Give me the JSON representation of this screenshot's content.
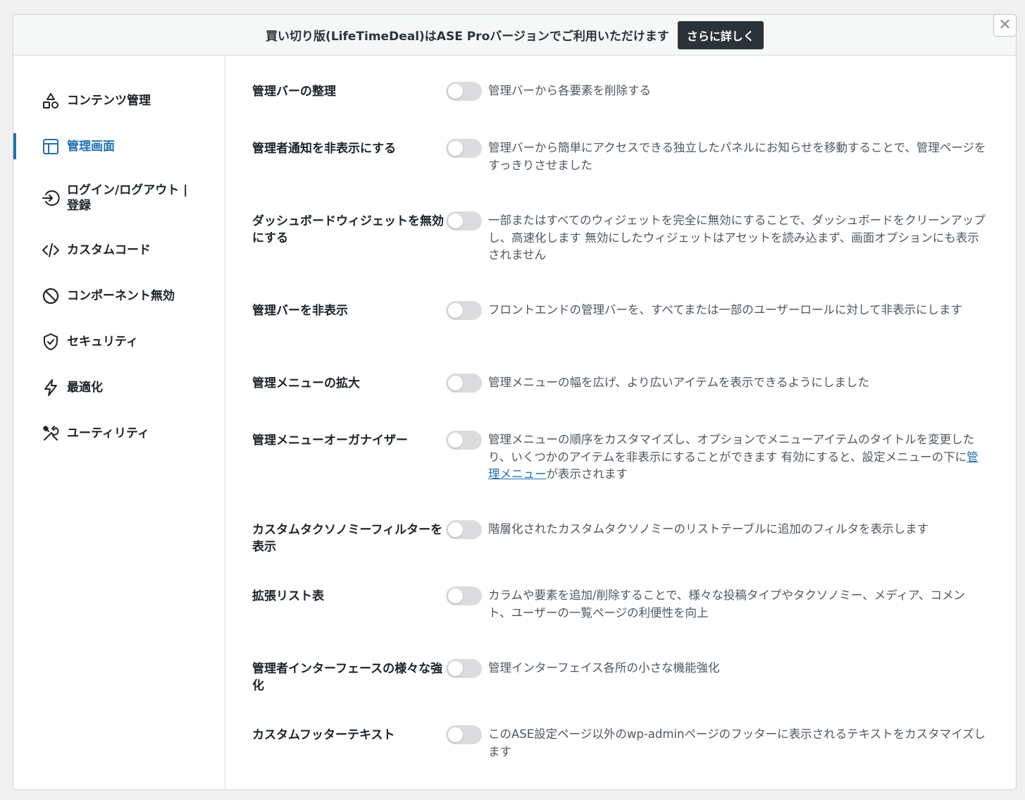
{
  "banner": {
    "text": "買い切り版(LifeTimeDeal)はASE Proバージョンでご利用いただけます",
    "button_label": "さらに詳しく"
  },
  "close_label": "✕",
  "sidebar": {
    "items": [
      {
        "label": "コンテンツ管理",
        "icon": "shapes-icon"
      },
      {
        "label": "管理画面",
        "icon": "layout-icon",
        "active": true
      },
      {
        "label": "ログイン/ログアウト | 登録",
        "icon": "login-icon"
      },
      {
        "label": "カスタムコード",
        "icon": "code-icon"
      },
      {
        "label": "コンポーネント無効",
        "icon": "ban-icon"
      },
      {
        "label": "セキュリティ",
        "icon": "shield-check-icon"
      },
      {
        "label": "最適化",
        "icon": "lightning-icon"
      },
      {
        "label": "ユーティリティ",
        "icon": "tools-icon"
      }
    ]
  },
  "settings": [
    {
      "title": "管理バーの整理",
      "desc": "管理バーから各要素を削除する",
      "enabled": false
    },
    {
      "title": "管理者通知を非表示にする",
      "desc": "管理バーから簡単にアクセスできる独立したパネルにお知らせを移動することで、管理ページをすっきりさせました",
      "enabled": false
    },
    {
      "title": "ダッシュボードウィジェットを無効にする",
      "desc": "一部またはすべてのウィジェットを完全に無効にすることで、ダッシュボードをクリーンアップし、高速化します 無効にしたウィジェットはアセットを読み込まず、画面オプションにも表示されません",
      "enabled": false
    },
    {
      "title": "管理バーを非表示",
      "desc": "フロントエンドの管理バーを、すべてまたは一部のユーザーロールに対して非表示にします",
      "enabled": false
    },
    {
      "title": "管理メニューの拡大",
      "desc": "管理メニューの幅を広げ、より広いアイテムを表示できるようにしました",
      "enabled": false
    },
    {
      "title": "管理メニューオーガナイザー",
      "desc_before": "管理メニューの順序をカスタマイズし、オプションでメニューアイテムのタイトルを変更したり、いくつかのアイテムを非表示にすることができます 有効にすると、設定メニューの下に",
      "desc_link": "管理メニュー",
      "desc_after": "が表示されます",
      "enabled": false
    },
    {
      "title": "カスタムタクソノミーフィルターを表示",
      "desc": "階層化されたカスタムタクソノミーのリストテーブルに追加のフィルタを表示します",
      "enabled": false
    },
    {
      "title": "拡張リスト表",
      "desc": "カラムや要素を追加/削除することで、様々な投稿タイプやタクソノミー、メディア、コメント、ユーザーの一覧ページの利便性を向上",
      "enabled": false
    },
    {
      "title": "管理者インターフェースの様々な強化",
      "desc": "管理インターフェイス各所の小さな機能強化",
      "enabled": false
    },
    {
      "title": "カスタムフッターテキスト",
      "desc": "このASE設定ページ以外のwp-adminページのフッターに表示されるテキストをカスタマイズします",
      "enabled": false
    }
  ]
}
